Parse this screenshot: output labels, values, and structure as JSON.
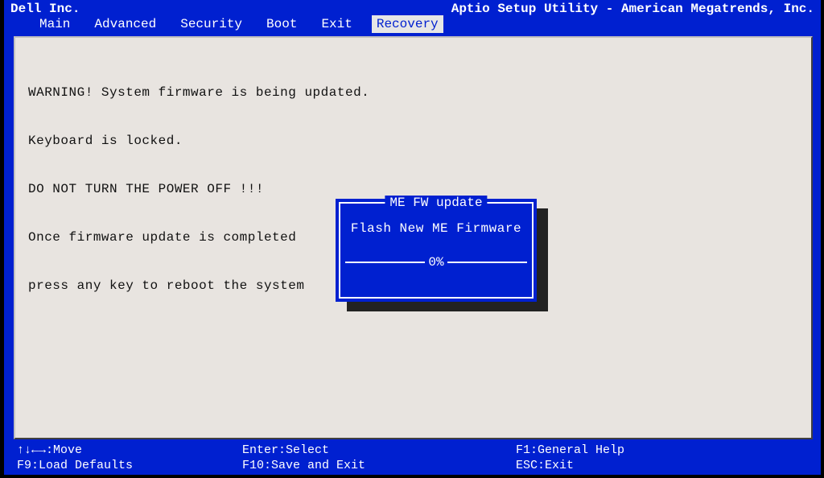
{
  "header": {
    "vendor": "Dell Inc.",
    "utility": "Aptio Setup Utility - American Megatrends, Inc."
  },
  "tabs": [
    {
      "label": "Main",
      "active": false
    },
    {
      "label": "Advanced",
      "active": false
    },
    {
      "label": "Security",
      "active": false
    },
    {
      "label": "Boot",
      "active": false
    },
    {
      "label": "Exit",
      "active": false
    },
    {
      "label": "Recovery",
      "active": true
    }
  ],
  "warning": {
    "line1": "WARNING! System firmware is being updated.",
    "line2": "Keyboard is locked.",
    "line3": "DO NOT TURN THE POWER OFF !!!",
    "line4": "Once firmware update is completed",
    "line5": "press any key to reboot the system"
  },
  "dialog": {
    "title": "ME FW update",
    "message": "Flash New ME Firmware",
    "progress": "0%"
  },
  "footer": {
    "move": "↑↓←→:Move",
    "defaults": "F9:Load Defaults",
    "select": "Enter:Select",
    "save": "F10:Save and Exit",
    "help": "F1:General Help",
    "exit": "ESC:Exit"
  }
}
